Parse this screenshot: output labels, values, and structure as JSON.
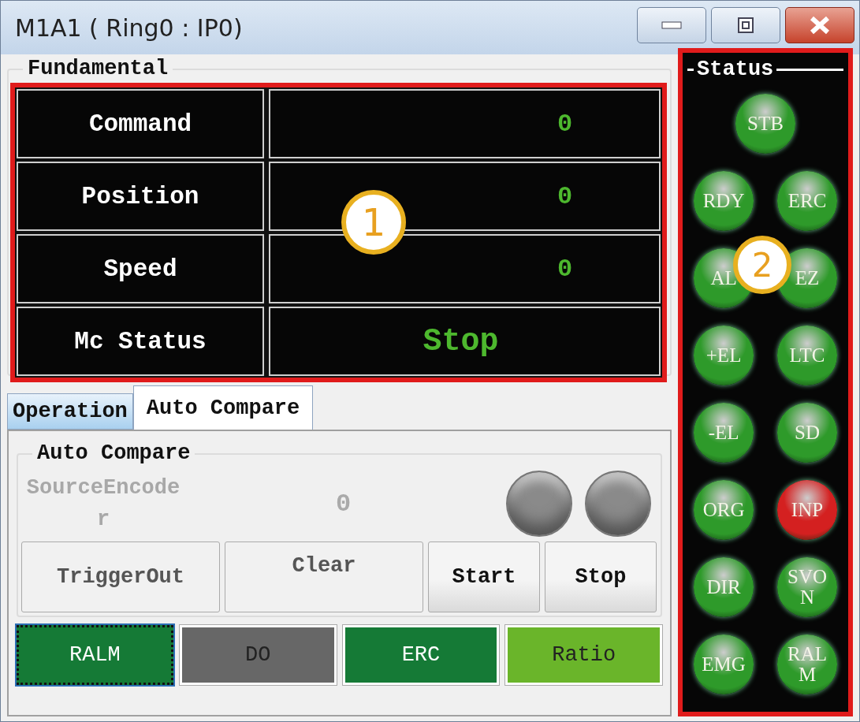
{
  "window": {
    "title": "M1A1 ( Ring0 : IP0)"
  },
  "fundamental": {
    "title": "Fundamental",
    "rows": [
      {
        "label": "Command",
        "value": "0",
        "kind": "number"
      },
      {
        "label": "Position",
        "value": "0",
        "kind": "number"
      },
      {
        "label": "Speed",
        "value": "0",
        "kind": "number"
      },
      {
        "label": "Mc Status",
        "value": "Stop",
        "kind": "status"
      }
    ]
  },
  "tabs": [
    {
      "label": "Operation",
      "selected": false
    },
    {
      "label": "Auto Compare",
      "selected": true
    }
  ],
  "auto_compare": {
    "title": "Auto Compare",
    "source_label": "SourceEncoder",
    "source_value": "0",
    "indicators": [
      {
        "color": "#8a8a8a"
      },
      {
        "color": "#8a8a8a"
      }
    ],
    "buttons": [
      {
        "label": "TriggerOut",
        "disabled": true
      },
      {
        "label": "Clear",
        "disabled": true
      },
      {
        "label": "Start",
        "disabled": false
      },
      {
        "label": "Stop",
        "disabled": false
      }
    ],
    "toggles": [
      {
        "label": "RALM",
        "color": "#157a36",
        "selected": true
      },
      {
        "label": "DO",
        "color": "#676767",
        "selected": false
      },
      {
        "label": "ERC",
        "color": "#157a36",
        "selected": false
      },
      {
        "label": "Ratio",
        "color": "#6ab52a",
        "selected": false
      }
    ]
  },
  "status": {
    "title": "Status",
    "leds": [
      {
        "label": "STB",
        "color": "#2e9a2a"
      },
      {
        "label": "RDY",
        "color": "#2e9a2a"
      },
      {
        "label": "ERC",
        "color": "#2e9a2a"
      },
      {
        "label": "AL",
        "color": "#2e9a2a"
      },
      {
        "label": "EZ",
        "color": "#2e9a2a"
      },
      {
        "label": "+EL",
        "color": "#2e9a2a"
      },
      {
        "label": "LTC",
        "color": "#2e9a2a"
      },
      {
        "label": "-EL",
        "color": "#2e9a2a"
      },
      {
        "label": "SD",
        "color": "#2e9a2a"
      },
      {
        "label": "ORG",
        "color": "#2e9a2a"
      },
      {
        "label": "INP",
        "color": "#d42020"
      },
      {
        "label": "DIR",
        "color": "#2e9a2a"
      },
      {
        "label": "SVO N",
        "color": "#2e9a2a"
      },
      {
        "label": "EMG",
        "color": "#2e9a2a"
      },
      {
        "label": "RAL M",
        "color": "#2e9a2a"
      }
    ]
  },
  "callouts": [
    "1",
    "2"
  ]
}
